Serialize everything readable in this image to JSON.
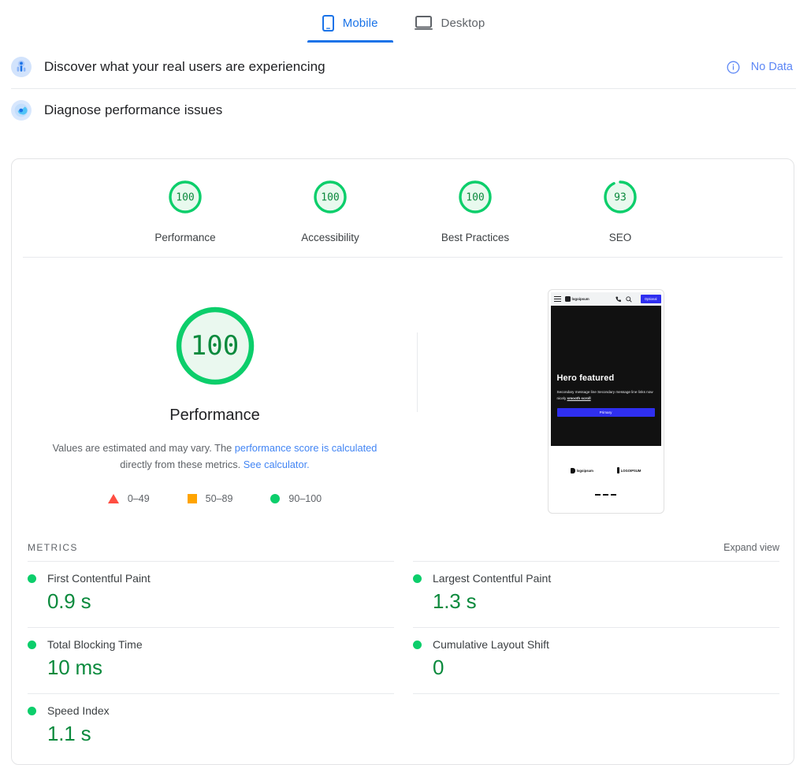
{
  "tabs": [
    {
      "label": "Mobile",
      "icon": "mobile-icon",
      "active": true
    },
    {
      "label": "Desktop",
      "icon": "desktop-icon",
      "active": false
    }
  ],
  "field_section": {
    "icon": "real-users-icon",
    "title": "Discover what your real users are experiencing",
    "status": "No Data",
    "status_icon": "info-icon"
  },
  "lab_section": {
    "icon": "lighthouse-icon",
    "title": "Diagnose performance issues"
  },
  "category_scores": [
    {
      "label": "Performance",
      "score": 100
    },
    {
      "label": "Accessibility",
      "score": 100
    },
    {
      "label": "Best Practices",
      "score": 100
    },
    {
      "label": "SEO",
      "score": 93
    }
  ],
  "hero": {
    "score": 100,
    "title": "Performance",
    "note_prefix": "Values are estimated and may vary. The ",
    "note_link1": "performance score is calculated",
    "note_middle": " directly from these metrics. ",
    "note_link2": "See calculator.",
    "legend": [
      {
        "shape": "triangle",
        "range": "0–49",
        "color": "#ff4e42"
      },
      {
        "shape": "square",
        "range": "50–89",
        "color": "#ffa400"
      },
      {
        "shape": "circle",
        "range": "90–100",
        "color": "#0cce6b"
      }
    ]
  },
  "screenshot": {
    "nav": {
      "menu_icon": "hamburger-icon",
      "brand": "logoipsum",
      "brand_icon": "logo-mark-icon",
      "phone_icon": "phone-icon",
      "search_icon": "search-icon",
      "cta": "Optional"
    },
    "hero_title": "Hero featured",
    "hero_sub_line1": "Secondary message line Secondary message",
    "hero_sub_line2": "line links now nicely ",
    "hero_sub_link": "smooth scroll",
    "primary_button": "Primary",
    "footer_logos": [
      {
        "text": "logoipsum",
        "mark": "logo-mark-icon"
      },
      {
        "text": "LOGOIPSUM",
        "mark": "logo-mark-icon"
      }
    ]
  },
  "metrics_panel": {
    "title": "METRICS",
    "expand_label": "Expand view",
    "items": [
      {
        "name": "First Contentful Paint",
        "value": "0.9 s",
        "status": "good"
      },
      {
        "name": "Largest Contentful Paint",
        "value": "1.3 s",
        "status": "good"
      },
      {
        "name": "Total Blocking Time",
        "value": "10 ms",
        "status": "good"
      },
      {
        "name": "Cumulative Layout Shift",
        "value": "0",
        "status": "good"
      },
      {
        "name": "Speed Index",
        "value": "1.1 s",
        "status": "good"
      }
    ]
  },
  "colors": {
    "good": "#0cce6b",
    "good_text": "#0b8a3d",
    "average": "#ffa400",
    "poor": "#ff4e42",
    "link": "#4285f4",
    "accent": "#1a73e8"
  }
}
